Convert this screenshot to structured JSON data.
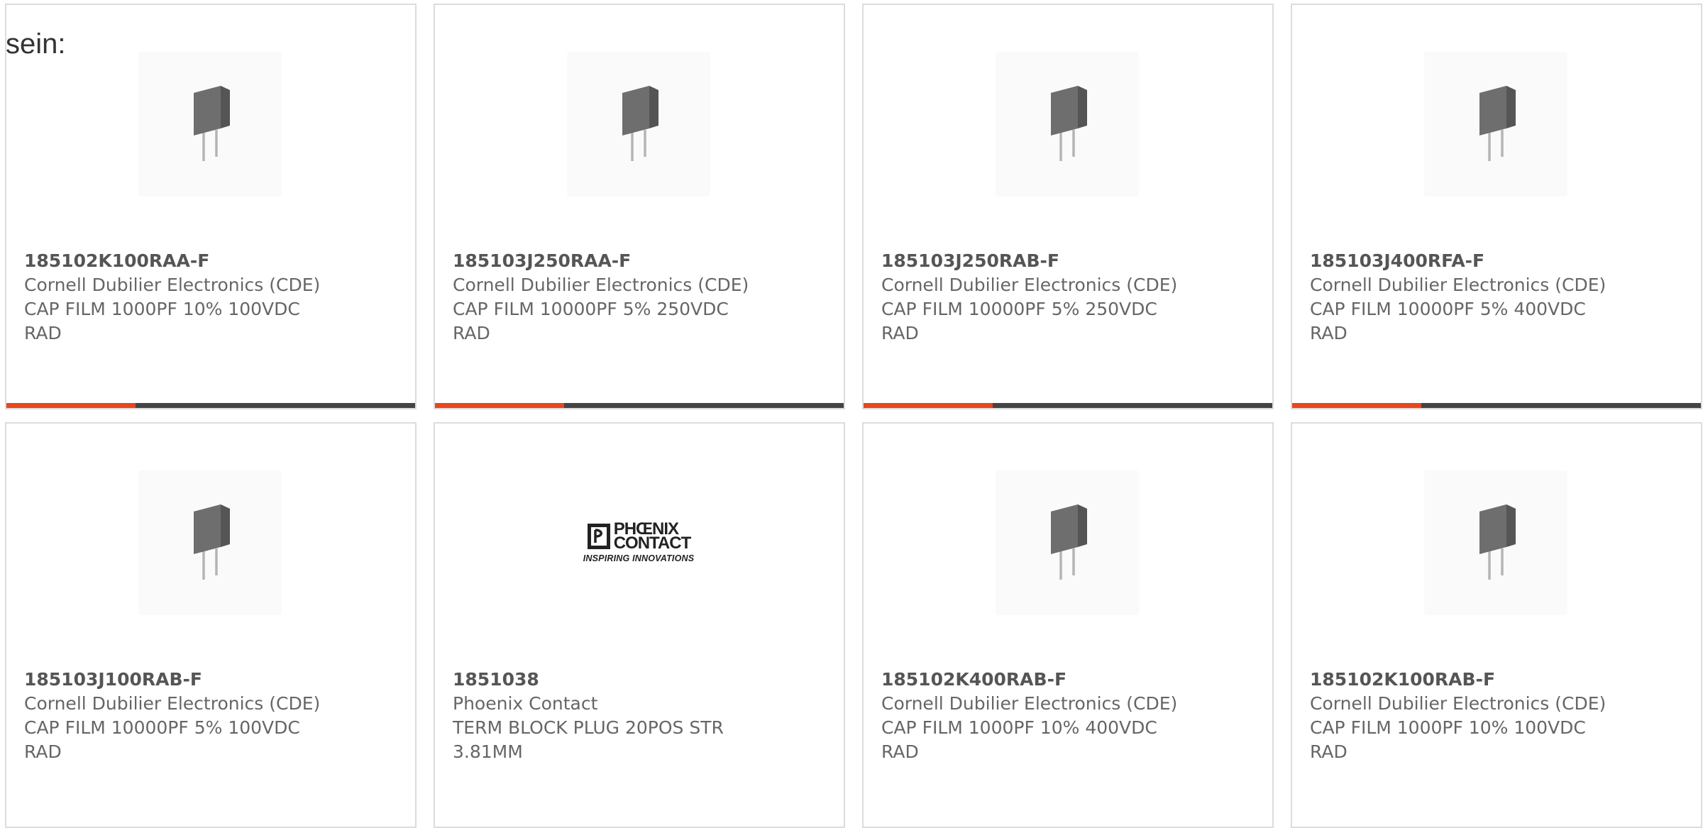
{
  "intro_text": "sein:",
  "colors": {
    "accent": "#e8461e",
    "bar_dark": "#444444",
    "border": "#dcdcdc"
  },
  "products": [
    {
      "part_number": "185102K100RAA-F",
      "manufacturer": "Cornell Dubilier Electronics (CDE)",
      "description": "CAP FILM 1000PF 10% 100VDC RAD",
      "image": "capacitor-icon",
      "highlighted": true
    },
    {
      "part_number": "185103J250RAA-F",
      "manufacturer": "Cornell Dubilier Electronics (CDE)",
      "description": "CAP FILM 10000PF 5% 250VDC RAD",
      "image": "capacitor-icon",
      "highlighted": true
    },
    {
      "part_number": "185103J250RAB-F",
      "manufacturer": "Cornell Dubilier Electronics (CDE)",
      "description": "CAP FILM 10000PF 5% 250VDC RAD",
      "image": "capacitor-icon",
      "highlighted": true
    },
    {
      "part_number": "185103J400RFA-F",
      "manufacturer": "Cornell Dubilier Electronics (CDE)",
      "description": "CAP FILM 10000PF 5% 400VDC RAD",
      "image": "capacitor-icon",
      "highlighted": true
    },
    {
      "part_number": "185103J100RAB-F",
      "manufacturer": "Cornell Dubilier Electronics (CDE)",
      "description": "CAP FILM 10000PF 5% 100VDC RAD",
      "image": "capacitor-icon",
      "highlighted": false
    },
    {
      "part_number": "1851038",
      "manufacturer": "Phoenix Contact",
      "description": "TERM BLOCK PLUG 20POS STR 3.81MM",
      "image": "phoenix-contact-logo",
      "logo_text_line1": "PHŒNIX",
      "logo_text_line2": "CONTACT",
      "logo_tagline": "INSPIRING INNOVATIONS",
      "highlighted": false
    },
    {
      "part_number": "185102K400RAB-F",
      "manufacturer": "Cornell Dubilier Electronics (CDE)",
      "description": "CAP FILM 1000PF 10% 400VDC RAD",
      "image": "capacitor-icon",
      "highlighted": false
    },
    {
      "part_number": "185102K100RAB-F",
      "manufacturer": "Cornell Dubilier Electronics (CDE)",
      "description": "CAP FILM 1000PF 10% 100VDC RAD",
      "image": "capacitor-icon",
      "highlighted": false
    }
  ]
}
